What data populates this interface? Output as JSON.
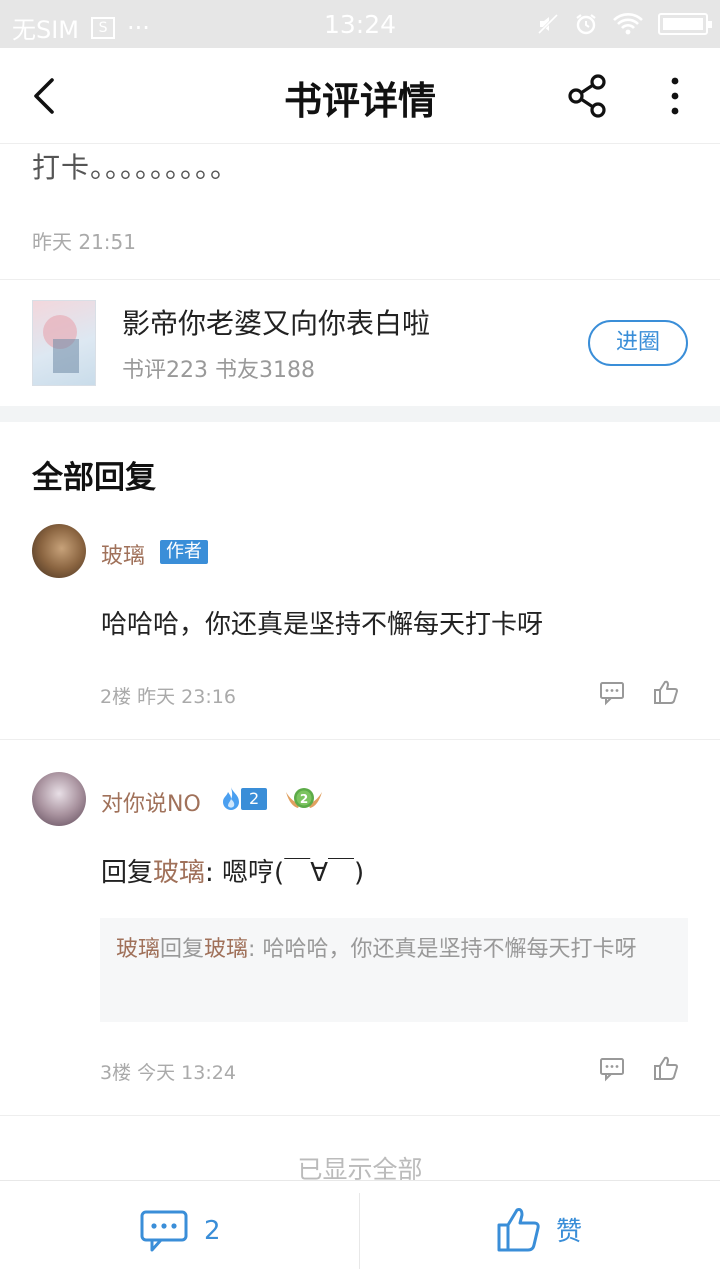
{
  "status_bar": {
    "carrier": "无SIM",
    "sim_icon_letter": "S",
    "dots": "···",
    "time": "13:24"
  },
  "nav": {
    "title": "书评详情"
  },
  "review": {
    "text_tail": "打卡。。。。。。。。。",
    "time": "昨天 21:51"
  },
  "book": {
    "title": "影帝你老婆又向你表白啦",
    "stats": "书评223 书友3188",
    "join_label": "进圈"
  },
  "replies_section": {
    "title": "全部回复",
    "items": [
      {
        "username": "玻璃",
        "badge": "作者",
        "body": "哈哈哈，你还真是坚持不懈每天打卡呀",
        "meta": "2楼 昨天 23:16"
      },
      {
        "username": "对你说NO",
        "fire_level": "2",
        "medal_level": "2",
        "body_prefix": "回复",
        "body_mention": "玻璃",
        "body_text": ": 嗯哼(￣∀￣)",
        "quote_user": "玻璃",
        "quote_reply_word": "回复",
        "quote_target": "玻璃",
        "quote_text": ": 哈哈哈，你还真是坚持不懈每天打卡呀",
        "meta": "3楼 今天 13:24"
      }
    ],
    "footer": "已显示全部"
  },
  "bottom_bar": {
    "comment_count": "2",
    "like_label": "赞"
  },
  "colors": {
    "accent": "#3a8ed8",
    "username": "#a0715a",
    "status_bar_bg": "#e6e6e6"
  }
}
